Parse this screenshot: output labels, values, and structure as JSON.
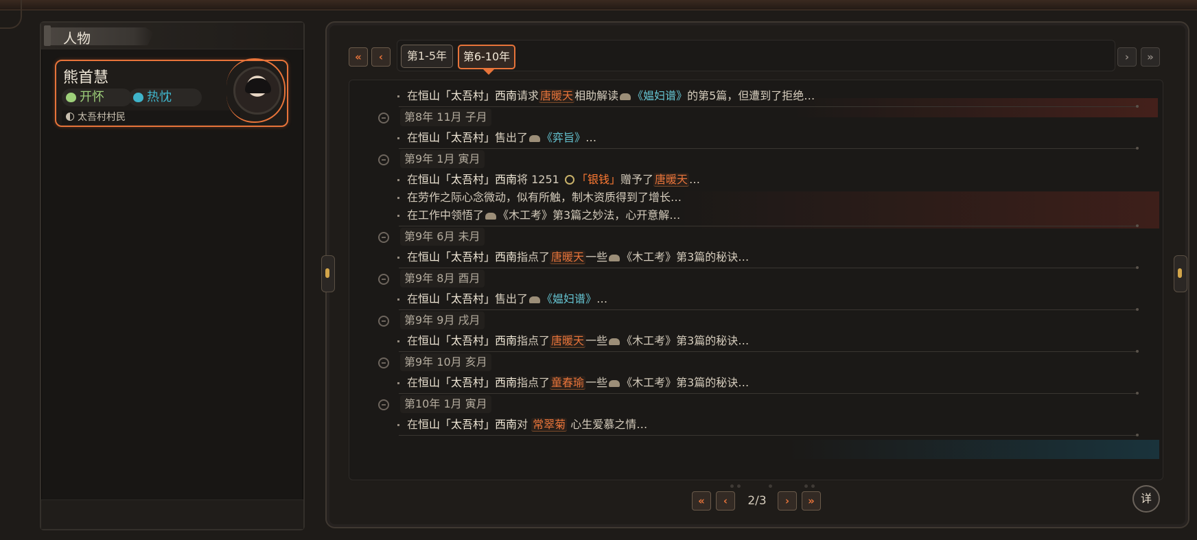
{
  "left": {
    "header": "人物",
    "character": {
      "name": "熊首慧",
      "moods": [
        {
          "label": "开怀",
          "color": "#9ed07a"
        },
        {
          "label": "热忱",
          "color": "#3fb3c9"
        }
      ],
      "role": "太吾村村民"
    }
  },
  "tabs": [
    {
      "label": "第1-5年",
      "active": false
    },
    {
      "label": "第6-10年",
      "active": true
    }
  ],
  "log": {
    "entries": [
      {
        "type": "event",
        "segments": [
          {
            "t": "在"
          },
          {
            "t": "恒山「太吾村」西南",
            "c": "p"
          },
          {
            "t": "请求"
          },
          {
            "t": "唐暖天",
            "c": "n"
          },
          {
            "t": "相助解读"
          },
          {
            "icon": "book"
          },
          {
            "t": "《媪妇谱》",
            "c": "b"
          },
          {
            "t": "的第5篇，但遭到了拒绝…"
          }
        ]
      },
      {
        "type": "date",
        "text": "第8年 11月 子月"
      },
      {
        "type": "event",
        "segments": [
          {
            "t": "在"
          },
          {
            "t": "恒山「太吾村」",
            "c": "p"
          },
          {
            "t": "售出了"
          },
          {
            "icon": "book"
          },
          {
            "t": "《弈旨》",
            "c": "b"
          },
          {
            "t": "…"
          }
        ]
      },
      {
        "type": "date",
        "text": "第9年 1月 寅月"
      },
      {
        "type": "event",
        "segments": [
          {
            "t": "在"
          },
          {
            "t": "恒山「太吾村」西南",
            "c": "p"
          },
          {
            "t": "将 1251 "
          },
          {
            "icon": "coin"
          },
          {
            "t": "「银钱」",
            "c": "m"
          },
          {
            "t": "赠予了"
          },
          {
            "t": "唐暖天",
            "c": "n"
          },
          {
            "t": "…"
          }
        ]
      },
      {
        "type": "event",
        "segments": [
          {
            "t": "在劳作之际心念微动，似有所触，制木资质得到了增长…"
          }
        ]
      },
      {
        "type": "event",
        "segments": [
          {
            "t": "在工作中领悟了"
          },
          {
            "icon": "book"
          },
          {
            "t": "《木工考》第3篇之妙法，心开意解…"
          }
        ]
      },
      {
        "type": "date",
        "text": "第9年 6月 未月"
      },
      {
        "type": "event",
        "segments": [
          {
            "t": "在"
          },
          {
            "t": "恒山「太吾村」西南",
            "c": "p"
          },
          {
            "t": "指点了"
          },
          {
            "t": "唐暖天",
            "c": "n"
          },
          {
            "t": "一些"
          },
          {
            "icon": "book"
          },
          {
            "t": "《木工考》第3篇的秘诀…"
          }
        ]
      },
      {
        "type": "date",
        "text": "第9年 8月 酉月"
      },
      {
        "type": "event",
        "segments": [
          {
            "t": "在"
          },
          {
            "t": "恒山「太吾村」",
            "c": "p"
          },
          {
            "t": "售出了"
          },
          {
            "icon": "book"
          },
          {
            "t": "《媪妇谱》",
            "c": "b"
          },
          {
            "t": "…"
          }
        ]
      },
      {
        "type": "date",
        "text": "第9年 9月 戌月"
      },
      {
        "type": "event",
        "segments": [
          {
            "t": "在"
          },
          {
            "t": "恒山「太吾村」西南",
            "c": "p"
          },
          {
            "t": "指点了"
          },
          {
            "t": "唐暖天",
            "c": "n"
          },
          {
            "t": "一些"
          },
          {
            "icon": "book"
          },
          {
            "t": "《木工考》第3篇的秘诀…"
          }
        ]
      },
      {
        "type": "date",
        "text": "第9年 10月 亥月"
      },
      {
        "type": "event",
        "segments": [
          {
            "t": "在"
          },
          {
            "t": "恒山「太吾村」西南",
            "c": "p"
          },
          {
            "t": "指点了"
          },
          {
            "t": "童春瑜",
            "c": "n"
          },
          {
            "t": "一些"
          },
          {
            "icon": "book"
          },
          {
            "t": "《木工考》第3篇的秘诀…"
          }
        ]
      },
      {
        "type": "date",
        "text": "第10年 1月 寅月"
      },
      {
        "type": "event",
        "segments": [
          {
            "t": "在"
          },
          {
            "t": "恒山「太吾村」西南",
            "c": "p"
          },
          {
            "t": "对 "
          },
          {
            "t": "常翠菊",
            "c": "n"
          },
          {
            "t": " 心生爱慕之情…"
          }
        ]
      }
    ]
  },
  "pager": {
    "page": "2/3",
    "detail_label": "详"
  },
  "nav_glyphs": {
    "first": "«",
    "prev": "‹",
    "next": "›",
    "last": "»"
  }
}
